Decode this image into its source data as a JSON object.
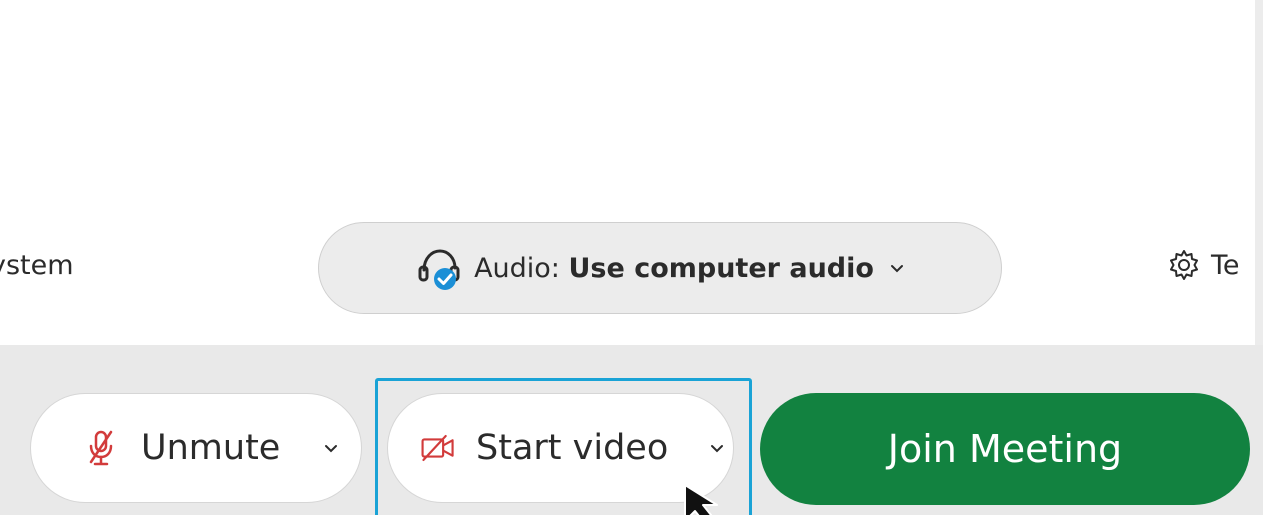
{
  "status_row": {
    "system_fragment": "ystem",
    "audio": {
      "prefix": "Audio: ",
      "value": "Use computer audio",
      "icon": "headset-check-icon"
    },
    "test_fragment": "Te",
    "test_icon": "gear-icon"
  },
  "controls": {
    "unmute": {
      "label": "Unmute",
      "icon": "microphone-muted-icon"
    },
    "video": {
      "label": "Start video",
      "icon": "video-off-icon",
      "focused": true
    },
    "join": {
      "label": "Join Meeting",
      "color": "#128240"
    }
  },
  "colors": {
    "accent_green": "#128240",
    "focus_ring": "#1aa3d6",
    "muted_red": "#d23b3b",
    "audio_check_blue": "#1b8fd6"
  }
}
